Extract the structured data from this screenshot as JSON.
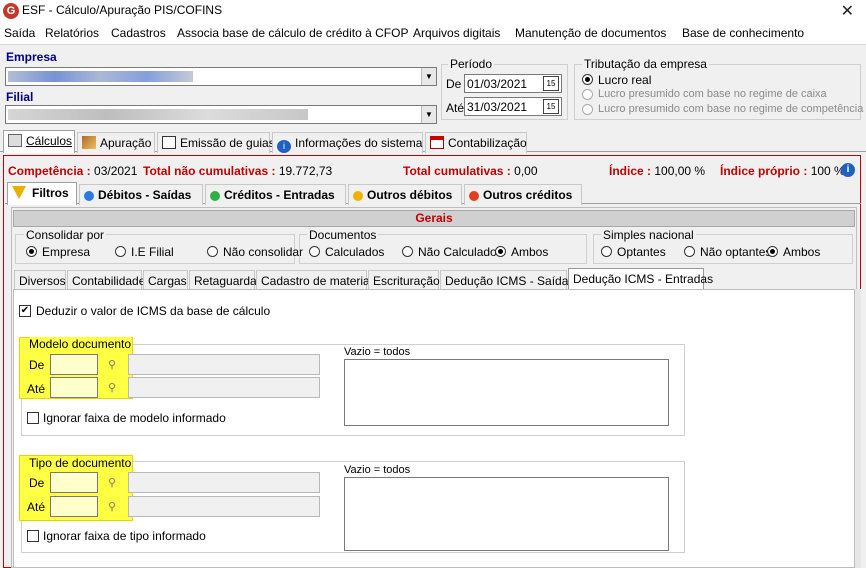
{
  "window": {
    "title": "ESF - Cálculo/Apuração PIS/COFINS",
    "icon_letter": "G",
    "close_glyph": "✕"
  },
  "menu": [
    "Saída",
    "Relatórios",
    "Cadastros",
    "Associa base de cálculo de crédito à CFOP",
    "Arquivos digitais",
    "Manutenção de documentos",
    "Base de conhecimento"
  ],
  "header": {
    "empresa_label": "Empresa",
    "filial_label": "Filial",
    "periodo": {
      "title": "Período",
      "de_label": "De",
      "de_value": "01/03/2021",
      "ate_label": "Até",
      "ate_value": "31/03/2021"
    },
    "tributacao": {
      "title": "Tributação da empresa",
      "options": [
        "Lucro real",
        "Lucro presumido com base no regime de caixa",
        "Lucro presumido com base no regime de competência"
      ],
      "selected": "Lucro real"
    }
  },
  "main_tabs": [
    "Cálculos",
    "Apuração",
    "Emissão de guias",
    "Informações do sistema",
    "Contabilização"
  ],
  "main_tab_active": "Cálculos",
  "status": {
    "competencia_label": "Competência :",
    "competencia_value": "03/2021",
    "nao_cum_label": "Total não cumulativas :",
    "nao_cum_value": "19.772,73",
    "cum_label": "Total cumulativas :",
    "cum_value": "0,00",
    "indice_label": "Índice :",
    "indice_value": "100,00 %",
    "indice_proprio_label": "Índice próprio :",
    "indice_proprio_value": "100 %"
  },
  "sub_tabs": [
    "Filtros",
    "Débitos - Saídas",
    "Créditos - Entradas",
    "Outros débitos",
    "Outros créditos"
  ],
  "sub_tab_active": "Filtros",
  "gerais": {
    "title": "Gerais",
    "consolidar": {
      "title": "Consolidar por",
      "options": [
        "Empresa",
        "I.E Filial",
        "Não consolidar"
      ],
      "selected": "Empresa"
    },
    "documentos": {
      "title": "Documentos",
      "options": [
        "Calculados",
        "Não Calculados",
        "Ambos"
      ],
      "selected": "Ambos"
    },
    "simples": {
      "title": "Simples nacional",
      "options": [
        "Optantes",
        "Não optantes",
        "Ambos"
      ],
      "selected": "Ambos"
    }
  },
  "filter_tabs": [
    "Diversos",
    "Contabilidade",
    "Cargas",
    "Retaguarda",
    "Cadastro de materiais",
    "Escrituração",
    "Dedução ICMS - Saídas",
    "Dedução ICMS - Entradas"
  ],
  "filter_tab_active": "Dedução ICMS - Entradas",
  "deducao": {
    "deduzir_label": "Deduzir o valor de ICMS da base de cálculo",
    "deduzir_checked": true,
    "modelo": {
      "title": "Modelo documento",
      "de_label": "De",
      "ate_label": "Até",
      "ignorar_label": "Ignorar faixa de modelo informado",
      "memo_label": "Vazio = todos"
    },
    "tipo": {
      "title": "Tipo de documento",
      "de_label": "De",
      "ate_label": "Até",
      "ignorar_label": "Ignorar faixa de tipo informado",
      "memo_label": "Vazio = todos"
    }
  }
}
